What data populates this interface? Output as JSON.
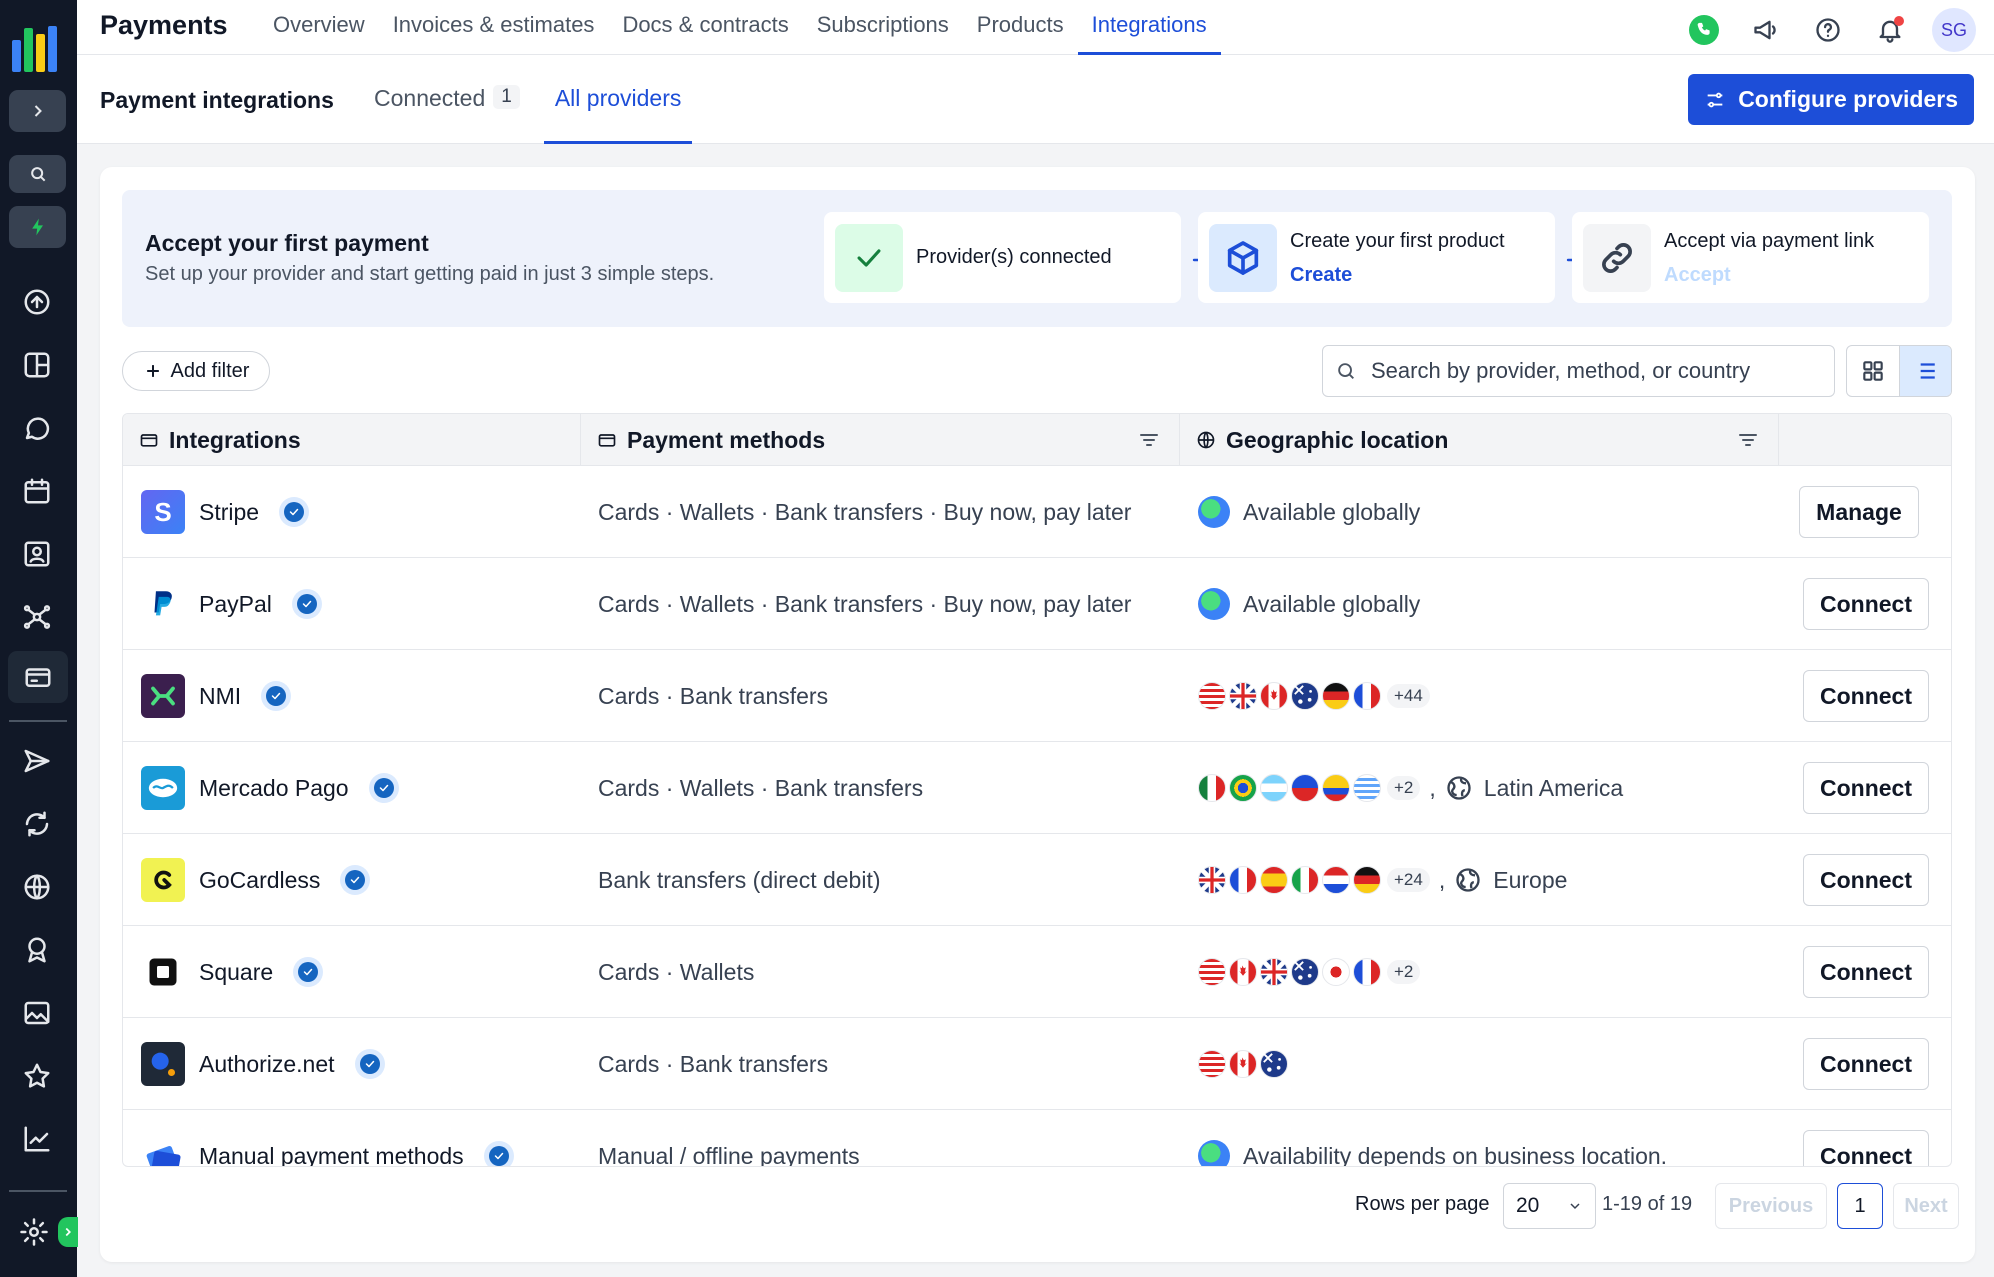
{
  "app": {
    "title": "Payments",
    "nav": [
      "Overview",
      "Invoices & estimates",
      "Docs & contracts",
      "Subscriptions",
      "Products",
      "Integrations"
    ],
    "active_nav": "Integrations",
    "avatar_initials": "SG"
  },
  "subheader": {
    "title": "Payment integrations",
    "tabs": [
      {
        "label": "Connected",
        "count": "1"
      },
      {
        "label": "All providers",
        "count": ""
      }
    ],
    "active_tab": "All providers",
    "configure_label": "Configure providers"
  },
  "banner": {
    "title": "Accept your first payment",
    "subtitle": "Set up your provider and start getting paid in just 3 simple steps.",
    "steps": [
      {
        "title": "Provider(s) connected",
        "link": "",
        "status": "done"
      },
      {
        "title": "Create your first product",
        "link": "Create",
        "status": "active"
      },
      {
        "title": "Accept via payment link",
        "link": "Accept",
        "status": "disabled"
      }
    ]
  },
  "toolbar": {
    "add_filter_label": "Add filter",
    "search_placeholder": "Search by provider, method, or country"
  },
  "table": {
    "columns": [
      "Integrations",
      "Payment methods",
      "Geographic location"
    ],
    "rows": [
      {
        "name": "Stripe",
        "methods": "Cards · Wallets · Bank transfers · Buy now, pay later",
        "location_type": "global",
        "location_text": "Available globally",
        "flags": [],
        "more": "",
        "region": "",
        "action": "Manage"
      },
      {
        "name": "PayPal",
        "methods": "Cards · Wallets · Bank transfers · Buy now, pay later",
        "location_type": "global",
        "location_text": "Available globally",
        "flags": [],
        "more": "",
        "region": "",
        "action": "Connect"
      },
      {
        "name": "NMI",
        "methods": "Cards · Bank transfers",
        "location_type": "flags",
        "location_text": "",
        "flags": [
          "us",
          "gb",
          "ca",
          "au",
          "de",
          "fr"
        ],
        "more": "+44",
        "region": "",
        "action": "Connect"
      },
      {
        "name": "Mercado Pago",
        "methods": "Cards · Wallets · Bank transfers",
        "location_type": "flags",
        "location_text": "",
        "flags": [
          "mx",
          "br",
          "ar",
          "cl",
          "co",
          "uy"
        ],
        "more": "+2",
        "region": "Latin America",
        "action": "Connect"
      },
      {
        "name": "GoCardless",
        "methods": "Bank transfers (direct debit)",
        "location_type": "flags",
        "location_text": "",
        "flags": [
          "gb",
          "fr",
          "es",
          "it",
          "nl",
          "de"
        ],
        "more": "+24",
        "region": "Europe",
        "action": "Connect"
      },
      {
        "name": "Square",
        "methods": "Cards · Wallets",
        "location_type": "flags",
        "location_text": "",
        "flags": [
          "us",
          "ca",
          "gb",
          "au",
          "jp",
          "fr"
        ],
        "more": "+2",
        "region": "",
        "action": "Connect"
      },
      {
        "name": "Authorize.net",
        "methods": "Cards · Bank transfers",
        "location_type": "flags",
        "location_text": "",
        "flags": [
          "us",
          "ca",
          "au"
        ],
        "more": "",
        "region": "",
        "action": "Connect"
      },
      {
        "name": "Manual payment methods",
        "methods": "Manual / offline payments",
        "location_type": "global",
        "location_text": "Availability depends on business location.",
        "flags": [],
        "more": "",
        "region": "",
        "action": "Connect"
      }
    ]
  },
  "pagination": {
    "rows_per_page_label": "Rows per page",
    "rows_per_page": "20",
    "range": "1-19 of 19",
    "previous": "Previous",
    "current_page": "1",
    "next": "Next"
  },
  "colors": {
    "accent": "#1d4ed8",
    "sidebar": "#111827",
    "banner_bg": "#eef2fb",
    "success": "#22c55e"
  }
}
